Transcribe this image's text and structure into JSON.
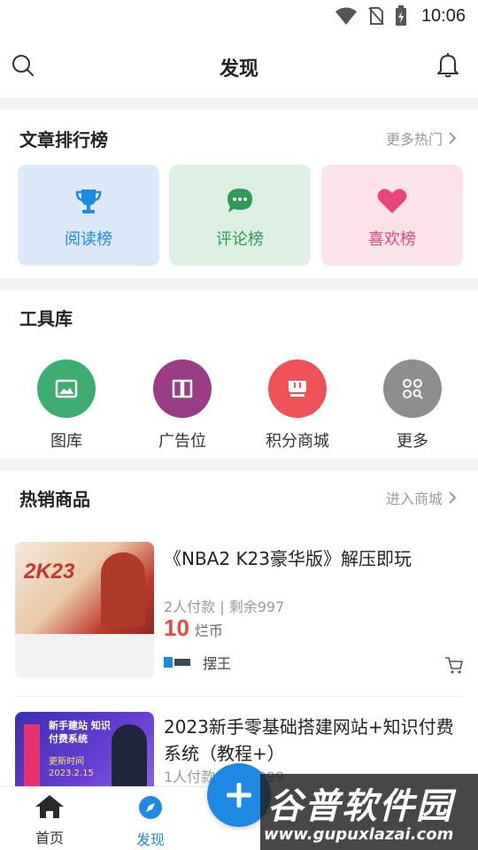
{
  "status_bar": {
    "time": "10:06",
    "icons": [
      "wifi-icon",
      "no-sim-icon",
      "battery-icon"
    ]
  },
  "header": {
    "title": "发现",
    "left_icon": "search-icon",
    "right_icon": "bell-icon"
  },
  "rankings": {
    "title": "文章排行榜",
    "more": "更多热门",
    "items": [
      {
        "label": "阅读榜",
        "icon": "trophy-icon",
        "bg": "#dbe9fb",
        "color": "#1e88e5"
      },
      {
        "label": "评论榜",
        "icon": "chat-bubble-icon",
        "bg": "#dcf1e4",
        "color": "#2e9b54"
      },
      {
        "label": "喜欢榜",
        "icon": "heart-icon",
        "bg": "#fce3ea",
        "color": "#e8457a"
      }
    ]
  },
  "tools": {
    "title": "工具库",
    "items": [
      {
        "label": "图库",
        "icon": "image-icon",
        "color": "#3dae6f"
      },
      {
        "label": "广告位",
        "icon": "book-icon",
        "color": "#9a3d84"
      },
      {
        "label": "积分商城",
        "icon": "shop-icon",
        "color": "#f0525a"
      },
      {
        "label": "更多",
        "icon": "grid-more-icon",
        "color": "#8e8e8e"
      }
    ]
  },
  "products": {
    "title": "热销商品",
    "more": "进入商城",
    "items": [
      {
        "title": "《NBA2 K23豪华版》解压即玩",
        "meta": "2人付款 | 剩余997",
        "price": "10",
        "unit": "烂币",
        "shop": "摆王",
        "thumb_text": "2K23"
      },
      {
        "title": "2023新手零基础搭建网站+知识付费系统（教程+）",
        "meta": "1人付款 | 剩余999",
        "thumb_text": "新手建站 知识付费系统",
        "thumb_sub": "更新时间 2023.2.15"
      }
    ]
  },
  "tab_bar": {
    "tabs": [
      {
        "label": "首页",
        "icon": "home-icon"
      },
      {
        "label": "发现",
        "icon": "compass-icon",
        "active": true
      }
    ],
    "fab_icon": "plus-icon"
  },
  "colors": {
    "accent": "#1e88e5",
    "price": "#e64940"
  },
  "watermark": {
    "text": "谷普软件园",
    "url": "www.gupuxlazai.com"
  }
}
